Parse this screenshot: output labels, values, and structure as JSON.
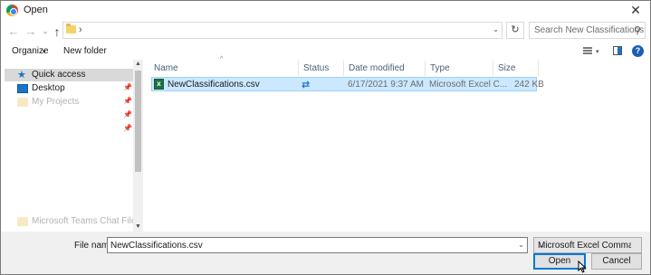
{
  "window": {
    "title": "Open"
  },
  "navigation": {
    "back_glyph": "←",
    "forward_glyph": "→",
    "recent_glyph": "⌄",
    "up_glyph": "↑"
  },
  "address": {
    "separator": "›",
    "dropdown_glyph": "⌄"
  },
  "refresh_glyph": "↻",
  "search": {
    "placeholder": "Search New Classifications",
    "icon": "search-icon"
  },
  "toolbar": {
    "organize_label": "Organize",
    "organize_arrow": "▾",
    "new_folder_label": "New folder",
    "view_arrow": "▾",
    "help_label": "?"
  },
  "nav_pane": {
    "items": [
      {
        "label": "Quick access",
        "icon": "star-icon",
        "selected": true
      },
      {
        "label": "Desktop",
        "icon": "desktop-icon",
        "pinned": true
      },
      {
        "label": "My Projects",
        "icon": "folder-icon",
        "pinned": true,
        "faded": true
      },
      {
        "label": "",
        "icon": "",
        "pinned": true
      },
      {
        "label": "",
        "icon": "",
        "pinned": true
      },
      {
        "label": "Microsoft Teams Chat Files",
        "icon": "folder-icon",
        "faded": true
      }
    ],
    "pin_glyph": "📌",
    "scroll_up": "▲",
    "scroll_down": "▼"
  },
  "file_list": {
    "columns": [
      "Name",
      "Status",
      "Date modified",
      "Type",
      "Size"
    ],
    "sort_glyph": "^",
    "rows": [
      {
        "name": "NewClassifications.csv",
        "status_icon": "sync-icon",
        "status_glyph": "⇄",
        "date_modified": "6/17/2021 9:37 AM",
        "type": "Microsoft Excel C...",
        "size": "242 KB",
        "selected": true
      }
    ]
  },
  "file_name": {
    "label": "File name:",
    "value": "NewClassifications.csv",
    "dropdown_glyph": "⌄"
  },
  "file_type": {
    "selected": "Microsoft Excel Comma Separa",
    "arrow": "⌄"
  },
  "buttons": {
    "open_label": "Open",
    "cancel_label": "Cancel"
  },
  "colors": {
    "selection_bg": "#cce8ff",
    "selection_border": "#99d1ff",
    "accent": "#0078d7"
  }
}
